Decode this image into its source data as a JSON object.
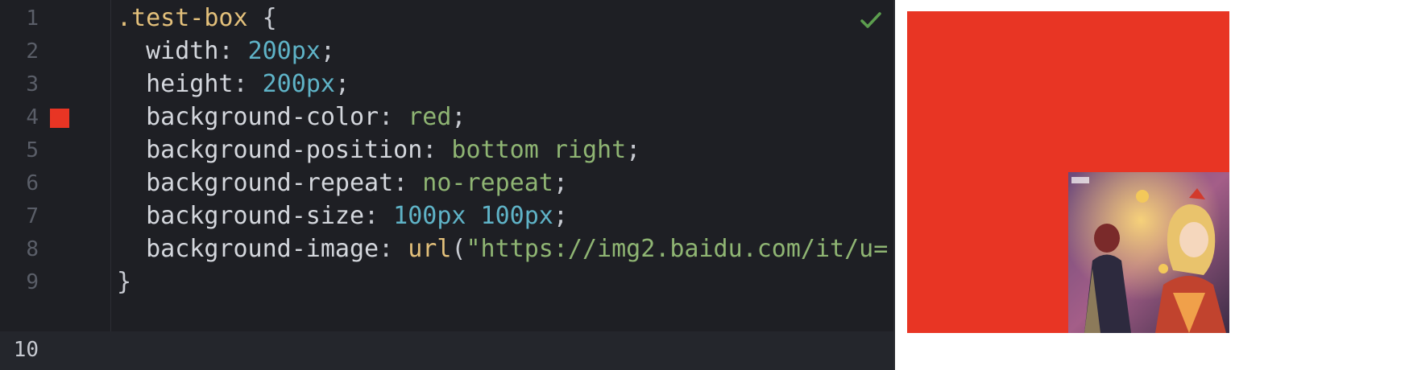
{
  "editor": {
    "lines": [
      {
        "number": "1",
        "tokens": [
          ".test-box",
          " {"
        ]
      },
      {
        "number": "2",
        "tokens": [
          "  width",
          ": ",
          "200",
          "px",
          ";"
        ]
      },
      {
        "number": "3",
        "tokens": [
          "  height",
          ": ",
          "200",
          "px",
          ";"
        ]
      },
      {
        "number": "4",
        "tokens": [
          "  background-color",
          ": ",
          "red",
          ";"
        ]
      },
      {
        "number": "5",
        "tokens": [
          "  background-position",
          ": ",
          "bottom right",
          ";"
        ]
      },
      {
        "number": "6",
        "tokens": [
          "  background-repeat",
          ": ",
          "no-repeat",
          ";"
        ]
      },
      {
        "number": "7",
        "tokens": [
          "  background-size",
          ": ",
          "100",
          "px ",
          "100",
          "px",
          ";"
        ]
      },
      {
        "number": "8",
        "tokens": [
          "  background-image",
          ": ",
          "url",
          "(",
          "\"https://img2.baidu.com/it/u="
        ]
      },
      {
        "number": "9",
        "tokens": [
          "}"
        ]
      },
      {
        "number": "10",
        "tokens": []
      }
    ],
    "active_line": "10",
    "status_icon": "check-icon",
    "swatch_color": "#e83524"
  },
  "preview": {
    "box_color": "#e83524",
    "image_label": "anime illustration"
  },
  "colors": {
    "editor_bg": "#1e1f24",
    "selector": "#e3c07b",
    "number": "#5fb3c7",
    "keyword": "#8fb573",
    "check": "#5c9e4e"
  }
}
